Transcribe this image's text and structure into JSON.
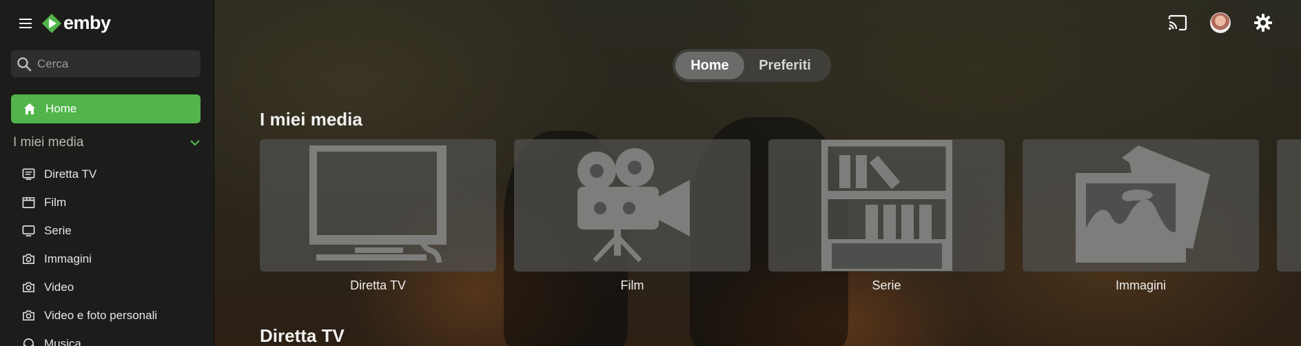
{
  "app": {
    "logo_text": "emby"
  },
  "search": {
    "placeholder": "Cerca"
  },
  "sidebar": {
    "home_label": "Home",
    "section_title": "I miei media",
    "items": [
      {
        "label": "Diretta TV",
        "icon": "tv-guide-icon"
      },
      {
        "label": "Film",
        "icon": "clapperboard-icon"
      },
      {
        "label": "Serie",
        "icon": "monitor-icon"
      },
      {
        "label": "Immagini",
        "icon": "camera-icon"
      },
      {
        "label": "Video",
        "icon": "camera-icon"
      },
      {
        "label": "Video e foto personali",
        "icon": "camera-icon"
      },
      {
        "label": "Musica",
        "icon": "headphones-icon"
      }
    ]
  },
  "tabs": [
    {
      "label": "Home",
      "active": true
    },
    {
      "label": "Preferiti",
      "active": false
    }
  ],
  "main": {
    "section1_title": "I miei media",
    "section2_title": "Diretta TV",
    "libraries": [
      {
        "label": "Diretta TV",
        "icon": "tv-icon"
      },
      {
        "label": "Film",
        "icon": "movie-camera-icon"
      },
      {
        "label": "Serie",
        "icon": "bookshelf-icon"
      },
      {
        "label": "Immagini",
        "icon": "photos-icon"
      }
    ]
  },
  "colors": {
    "accent": "#52b54b",
    "sidebar_bg": "#1c1d1a"
  }
}
